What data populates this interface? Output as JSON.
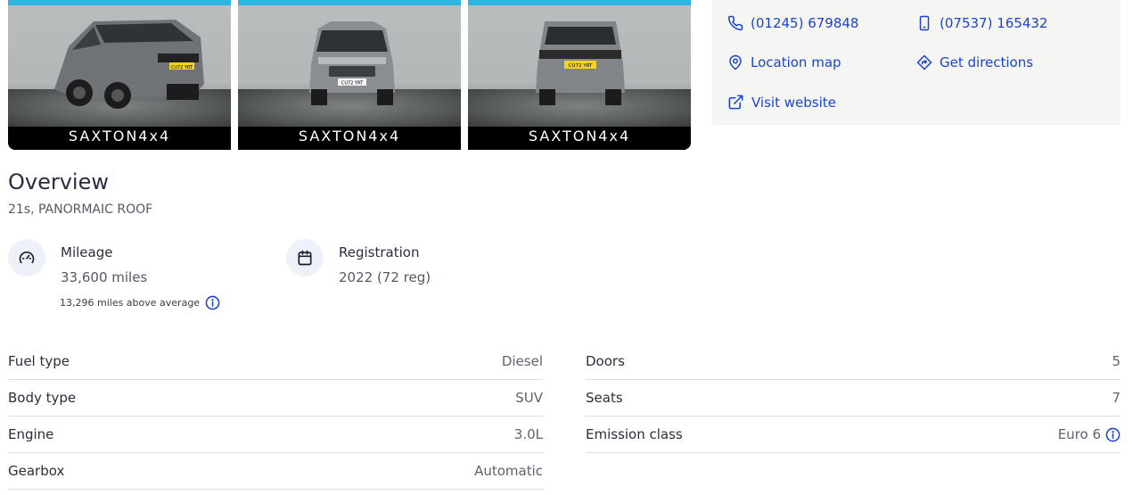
{
  "gallery": {
    "photos": [
      {
        "view": "rear-three-quarter",
        "plate": "CU72 YRT",
        "watermark": "SAXTON4x4"
      },
      {
        "view": "front",
        "plate": "CU72 YRT",
        "watermark": "SAXTON4x4"
      },
      {
        "view": "rear",
        "plate": "CU72 YRT",
        "watermark": "SAXTON4x4"
      }
    ]
  },
  "dealer": {
    "phone": "(01245) 679848",
    "mobile": "(07537) 165432",
    "location_map": "Location map",
    "directions": "Get directions",
    "website": "Visit website",
    "link_color": "#1944cf"
  },
  "overview": {
    "title": "Overview",
    "subtitle": "21s, PANORMAIC ROOF"
  },
  "stats": {
    "mileage": {
      "label": "Mileage",
      "value": "33,600 miles",
      "note": "13,296 miles above average",
      "icon": "speedometer-icon"
    },
    "registration": {
      "label": "Registration",
      "value": "2022 (72 reg)",
      "icon": "calendar-icon"
    }
  },
  "specs": {
    "left": [
      {
        "key": "Fuel type",
        "value": "Diesel"
      },
      {
        "key": "Body type",
        "value": "SUV"
      },
      {
        "key": "Engine",
        "value": "3.0L"
      },
      {
        "key": "Gearbox",
        "value": "Automatic"
      }
    ],
    "right": [
      {
        "key": "Doors",
        "value": "5"
      },
      {
        "key": "Seats",
        "value": "7"
      },
      {
        "key": "Emission class",
        "value": "Euro 6"
      }
    ]
  }
}
